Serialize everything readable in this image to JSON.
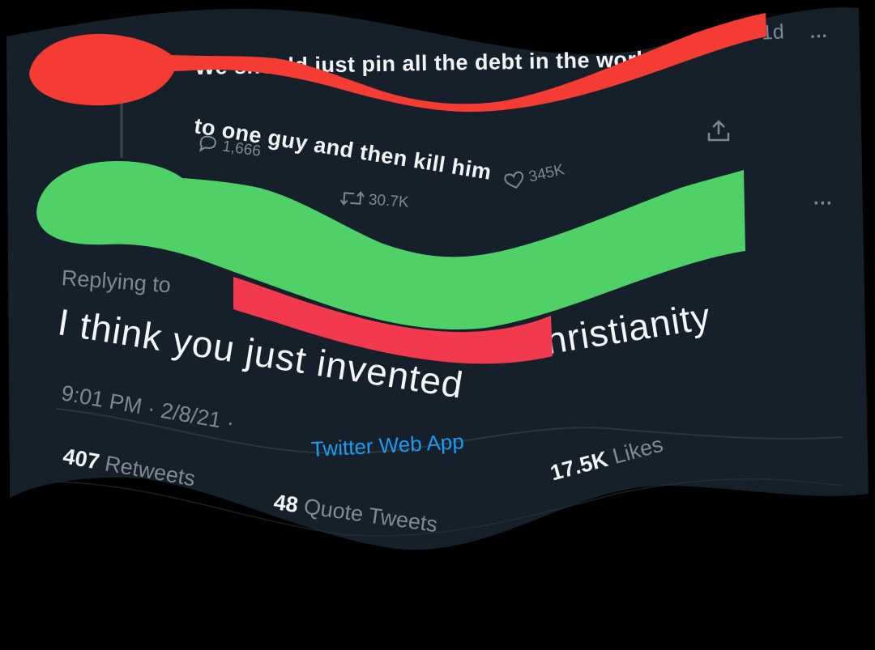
{
  "colors": {
    "background": "#15202b",
    "text": "#f2f4f6",
    "muted": "#7d8893",
    "link": "#1d9bf0",
    "redaction_red": "#f43b34",
    "redaction_pink_red": "#f2394d",
    "redaction_green": "#4fd168"
  },
  "original_tweet": {
    "time": "1d",
    "menu": "···",
    "text_line1": "We should just pin all the debt in the world",
    "text_line2": "to one guy and then kill him",
    "replies": "1,666",
    "retweets": "30.7K",
    "likes": "345K",
    "reply_icon": "comment-icon",
    "retweet_icon": "retweet-icon",
    "like_icon": "heart-icon",
    "share_icon": "share-icon"
  },
  "reply_tweet": {
    "menu": "···",
    "replying_to": "Replying to",
    "text_part1": "I think you just invented",
    "text_part2": "Christianity",
    "time": "9:01 PM",
    "sep1": "·",
    "date": "2/8/21",
    "sep2": "·",
    "source": "Twitter Web App",
    "retweets_count": "407",
    "retweets_label": "Retweets",
    "quote_count": "48",
    "quote_label": "Quote Tweets",
    "likes_count": "17.5K",
    "likes_label": "Likes"
  }
}
